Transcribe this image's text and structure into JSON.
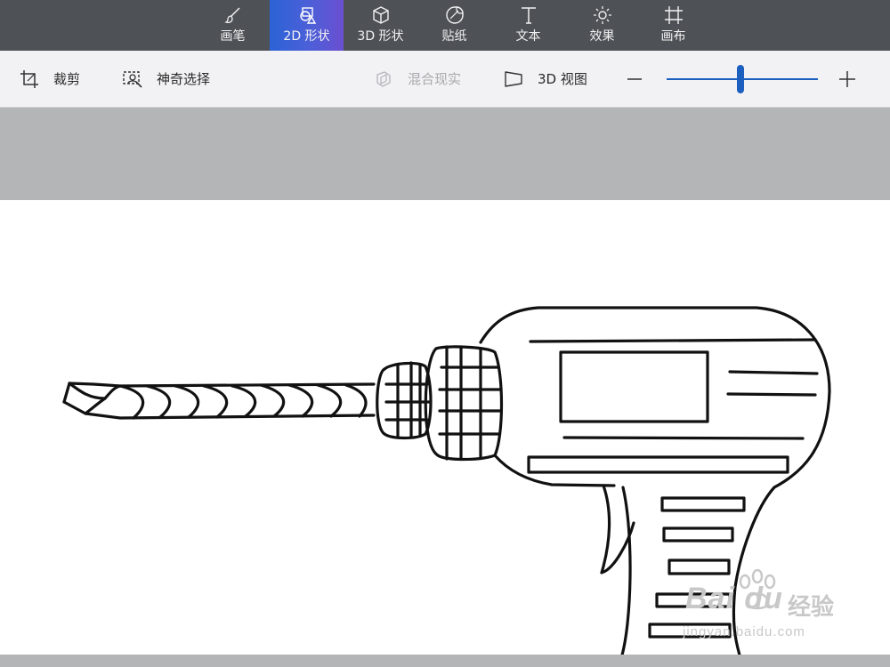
{
  "tabs": [
    {
      "label": "画笔",
      "icon": "brush-icon",
      "active": false
    },
    {
      "label": "2D 形状",
      "icon": "2d-shapes-icon",
      "active": true
    },
    {
      "label": "3D 形状",
      "icon": "3d-cube-icon",
      "active": false
    },
    {
      "label": "贴纸",
      "icon": "sticker-icon",
      "active": false
    },
    {
      "label": "文本",
      "icon": "text-icon",
      "active": false
    },
    {
      "label": "效果",
      "icon": "sun-icon",
      "active": false
    },
    {
      "label": "画布",
      "icon": "canvas-icon",
      "active": false
    }
  ],
  "toolbar": {
    "crop_label": "裁剪",
    "magic_select_label": "神奇选择",
    "mixed_reality_label": "混合现实",
    "mixed_reality_enabled": false,
    "view3d_label": "3D 视图",
    "zoom_level_fraction": 0.49
  },
  "colors": {
    "tab_bar": "#4e5156",
    "active_tab": "#3d5fd8",
    "accent": "#1d5fbf",
    "workspace": "#b4b5b7",
    "toolbar": "#f2f2f4"
  },
  "canvas": {
    "drawing_subject": "electric-drill-line-drawing"
  },
  "watermark": {
    "logo": "Bai du",
    "cn": "经验",
    "url": "jingyan.baidu.com"
  }
}
